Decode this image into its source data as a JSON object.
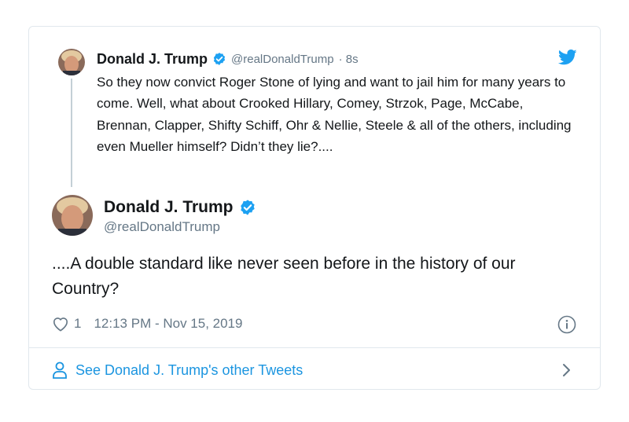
{
  "parent_tweet": {
    "author_name": "Donald J. Trump",
    "handle": "@realDonaldTrump",
    "time_ago": "· 8s",
    "text": "So they now convict Roger Stone of lying and want to jail him for many years to come. Well, what about Crooked Hillary, Comey, Strzok, Page, McCabe, Brennan, Clapper, Shifty Schiff, Ohr & Nellie, Steele & all of the others, including even Mueller himself? Didn’t they lie?...."
  },
  "main_tweet": {
    "author_name": "Donald J. Trump",
    "handle": "@realDonaldTrump",
    "text": "....A double standard like never seen before in the history of our Country?",
    "like_count": "1",
    "timestamp": "12:13 PM - Nov 15, 2019"
  },
  "footer": {
    "link_label": "See Donald J. Trump's other Tweets"
  },
  "icons": {
    "verified": "verified-badge-icon",
    "brand": "twitter-bird-icon",
    "like": "heart-icon",
    "info": "info-icon",
    "profile": "person-icon",
    "more": "chevron-right-icon"
  },
  "colors": {
    "accent": "#1DA1F2",
    "link": "#1B95E0",
    "secondary_text": "#657786",
    "border": "#E1E8ED"
  }
}
